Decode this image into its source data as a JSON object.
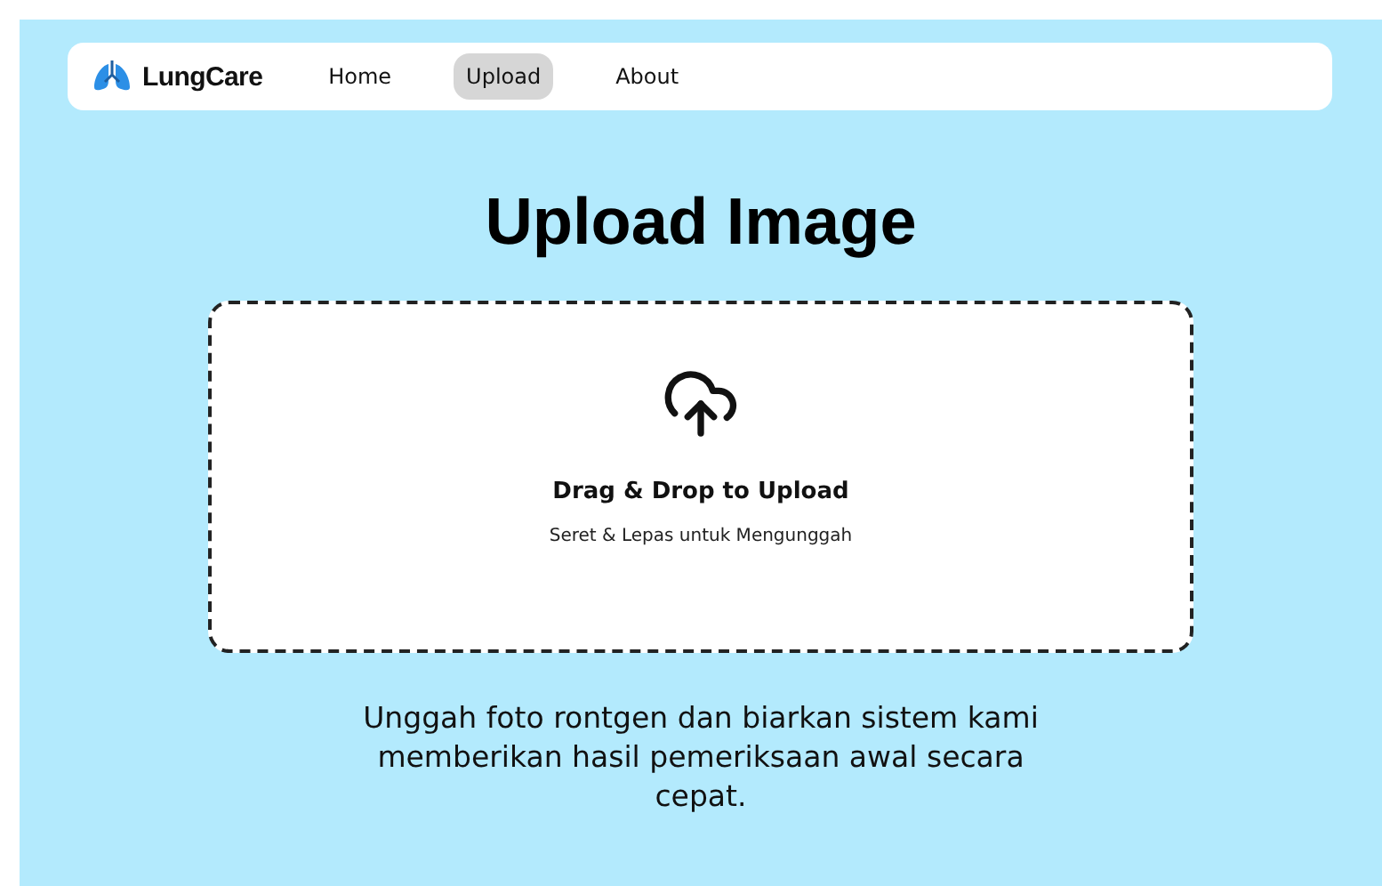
{
  "navbar": {
    "brand": "LungCare",
    "links": [
      {
        "label": "Home",
        "selected": false
      },
      {
        "label": "Upload",
        "selected": true
      },
      {
        "label": "About",
        "selected": false
      }
    ]
  },
  "title": "Upload Image",
  "dropzone": {
    "heading": "Drag & Drop to Upload",
    "subheading": "Seret & Lepas untuk Mengunggah"
  },
  "description": "Unggah foto rontgen dan biarkan sistem kami memberikan hasil pemeriksaan awal secara cepat."
}
